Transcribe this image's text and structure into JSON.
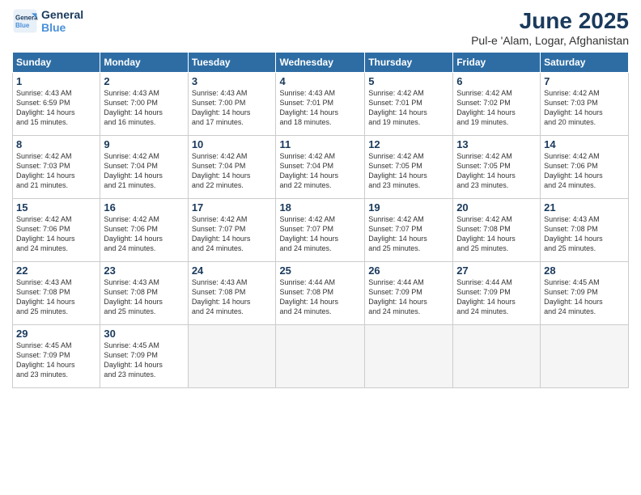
{
  "logo": {
    "line1": "General",
    "line2": "Blue"
  },
  "title": "June 2025",
  "subtitle": "Pul-e 'Alam, Logar, Afghanistan",
  "days_of_week": [
    "Sunday",
    "Monday",
    "Tuesday",
    "Wednesday",
    "Thursday",
    "Friday",
    "Saturday"
  ],
  "weeks": [
    [
      {
        "day": 1,
        "info": "Sunrise: 4:43 AM\nSunset: 6:59 PM\nDaylight: 14 hours\nand 15 minutes."
      },
      {
        "day": 2,
        "info": "Sunrise: 4:43 AM\nSunset: 7:00 PM\nDaylight: 14 hours\nand 16 minutes."
      },
      {
        "day": 3,
        "info": "Sunrise: 4:43 AM\nSunset: 7:00 PM\nDaylight: 14 hours\nand 17 minutes."
      },
      {
        "day": 4,
        "info": "Sunrise: 4:43 AM\nSunset: 7:01 PM\nDaylight: 14 hours\nand 18 minutes."
      },
      {
        "day": 5,
        "info": "Sunrise: 4:42 AM\nSunset: 7:01 PM\nDaylight: 14 hours\nand 19 minutes."
      },
      {
        "day": 6,
        "info": "Sunrise: 4:42 AM\nSunset: 7:02 PM\nDaylight: 14 hours\nand 19 minutes."
      },
      {
        "day": 7,
        "info": "Sunrise: 4:42 AM\nSunset: 7:03 PM\nDaylight: 14 hours\nand 20 minutes."
      }
    ],
    [
      {
        "day": 8,
        "info": "Sunrise: 4:42 AM\nSunset: 7:03 PM\nDaylight: 14 hours\nand 21 minutes."
      },
      {
        "day": 9,
        "info": "Sunrise: 4:42 AM\nSunset: 7:04 PM\nDaylight: 14 hours\nand 21 minutes."
      },
      {
        "day": 10,
        "info": "Sunrise: 4:42 AM\nSunset: 7:04 PM\nDaylight: 14 hours\nand 22 minutes."
      },
      {
        "day": 11,
        "info": "Sunrise: 4:42 AM\nSunset: 7:04 PM\nDaylight: 14 hours\nand 22 minutes."
      },
      {
        "day": 12,
        "info": "Sunrise: 4:42 AM\nSunset: 7:05 PM\nDaylight: 14 hours\nand 23 minutes."
      },
      {
        "day": 13,
        "info": "Sunrise: 4:42 AM\nSunset: 7:05 PM\nDaylight: 14 hours\nand 23 minutes."
      },
      {
        "day": 14,
        "info": "Sunrise: 4:42 AM\nSunset: 7:06 PM\nDaylight: 14 hours\nand 24 minutes."
      }
    ],
    [
      {
        "day": 15,
        "info": "Sunrise: 4:42 AM\nSunset: 7:06 PM\nDaylight: 14 hours\nand 24 minutes."
      },
      {
        "day": 16,
        "info": "Sunrise: 4:42 AM\nSunset: 7:06 PM\nDaylight: 14 hours\nand 24 minutes."
      },
      {
        "day": 17,
        "info": "Sunrise: 4:42 AM\nSunset: 7:07 PM\nDaylight: 14 hours\nand 24 minutes."
      },
      {
        "day": 18,
        "info": "Sunrise: 4:42 AM\nSunset: 7:07 PM\nDaylight: 14 hours\nand 24 minutes."
      },
      {
        "day": 19,
        "info": "Sunrise: 4:42 AM\nSunset: 7:07 PM\nDaylight: 14 hours\nand 25 minutes."
      },
      {
        "day": 20,
        "info": "Sunrise: 4:42 AM\nSunset: 7:08 PM\nDaylight: 14 hours\nand 25 minutes."
      },
      {
        "day": 21,
        "info": "Sunrise: 4:43 AM\nSunset: 7:08 PM\nDaylight: 14 hours\nand 25 minutes."
      }
    ],
    [
      {
        "day": 22,
        "info": "Sunrise: 4:43 AM\nSunset: 7:08 PM\nDaylight: 14 hours\nand 25 minutes."
      },
      {
        "day": 23,
        "info": "Sunrise: 4:43 AM\nSunset: 7:08 PM\nDaylight: 14 hours\nand 25 minutes."
      },
      {
        "day": 24,
        "info": "Sunrise: 4:43 AM\nSunset: 7:08 PM\nDaylight: 14 hours\nand 24 minutes."
      },
      {
        "day": 25,
        "info": "Sunrise: 4:44 AM\nSunset: 7:08 PM\nDaylight: 14 hours\nand 24 minutes."
      },
      {
        "day": 26,
        "info": "Sunrise: 4:44 AM\nSunset: 7:09 PM\nDaylight: 14 hours\nand 24 minutes."
      },
      {
        "day": 27,
        "info": "Sunrise: 4:44 AM\nSunset: 7:09 PM\nDaylight: 14 hours\nand 24 minutes."
      },
      {
        "day": 28,
        "info": "Sunrise: 4:45 AM\nSunset: 7:09 PM\nDaylight: 14 hours\nand 24 minutes."
      }
    ],
    [
      {
        "day": 29,
        "info": "Sunrise: 4:45 AM\nSunset: 7:09 PM\nDaylight: 14 hours\nand 23 minutes."
      },
      {
        "day": 30,
        "info": "Sunrise: 4:45 AM\nSunset: 7:09 PM\nDaylight: 14 hours\nand 23 minutes."
      },
      null,
      null,
      null,
      null,
      null
    ]
  ]
}
